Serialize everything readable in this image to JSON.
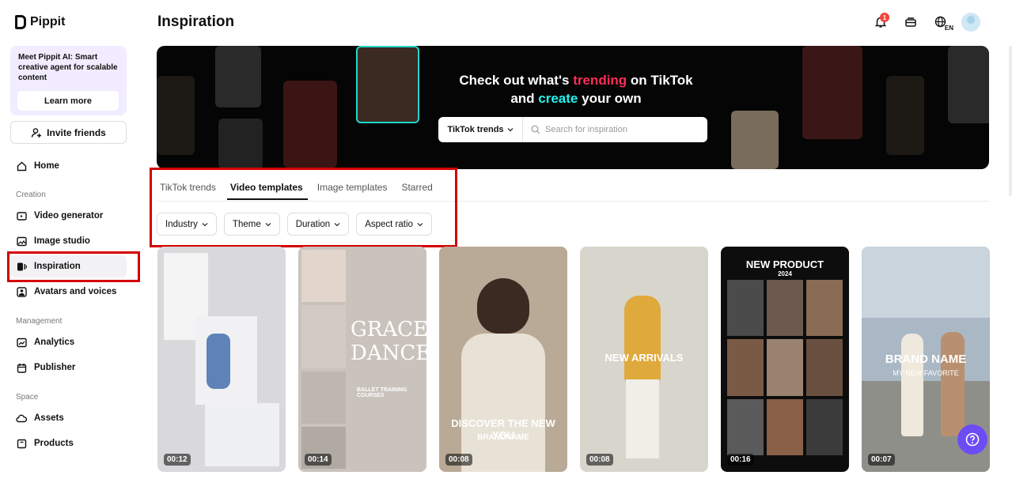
{
  "app": {
    "name": "Pippit"
  },
  "promo": {
    "text": "Meet Pippit AI: Smart creative agent for scalable content",
    "button": "Learn more"
  },
  "invite": {
    "label": "Invite friends"
  },
  "nav": {
    "home": "Home",
    "creation_header": "Creation",
    "video_generator": "Video generator",
    "image_studio": "Image studio",
    "inspiration": "Inspiration",
    "avatars": "Avatars and voices",
    "management_header": "Management",
    "analytics": "Analytics",
    "publisher": "Publisher",
    "space_header": "Space",
    "assets": "Assets",
    "products": "Products"
  },
  "header": {
    "title": "Inspiration",
    "notification_count": "1",
    "lang": "EN"
  },
  "hero": {
    "line1_a": "Check out what's ",
    "line1_b": "trending",
    "line1_c": " on TikTok",
    "line2_a": "and ",
    "line2_b": "create",
    "line2_c": " your own",
    "select_value": "TikTok trends",
    "search_placeholder": "Search for inspiration"
  },
  "tabs": [
    "TikTok trends",
    "Video templates",
    "Image templates",
    "Starred"
  ],
  "filters": [
    "Industry",
    "Theme",
    "Duration",
    "Aspect ratio"
  ],
  "cards": [
    {
      "duration": "00:12",
      "text": "",
      "bg": "#d9d9dc"
    },
    {
      "duration": "00:14",
      "text": "GRACEFU DANCE",
      "sub": "BALLET TRAINING COURSES",
      "bg": "#c9c3bc"
    },
    {
      "duration": "00:08",
      "text": "DISCOVER THE NEW YOU",
      "sub": "BRANDNAME",
      "bg": "#b9aa97"
    },
    {
      "duration": "00:08",
      "text": "NEW ARRIVALS",
      "bg": "#d8d6cc"
    },
    {
      "duration": "00:16",
      "text": "NEW PRODUCT",
      "sub": "2024",
      "bg": "#0d0d0d"
    },
    {
      "duration": "00:07",
      "text": "BRAND NAME",
      "sub": "MY NEW FAVORITE",
      "bg": "#a9b8c4"
    }
  ],
  "colors": {
    "accent": "#6c4cf5",
    "highlight_box": "#d40000",
    "tiktok_pink": "#fe2c55",
    "tiktok_cyan": "#25f4ee"
  }
}
